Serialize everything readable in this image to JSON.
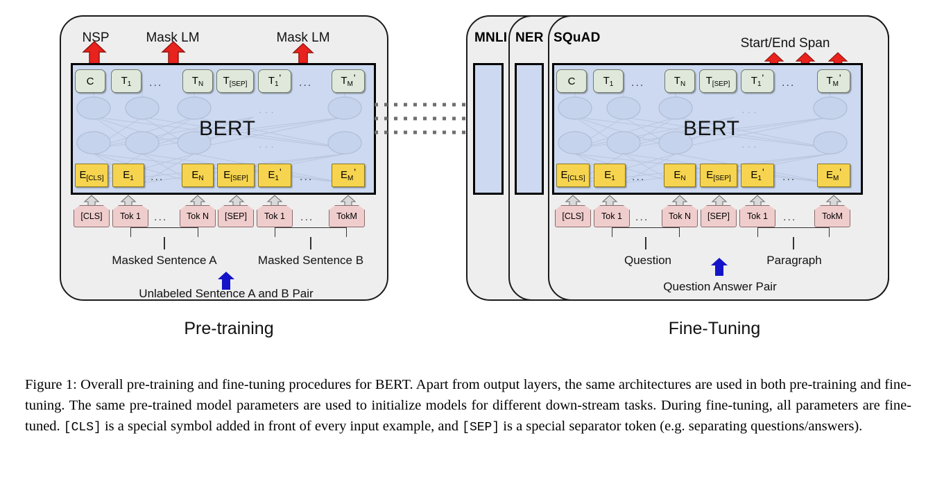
{
  "figure": {
    "left_panel": {
      "phase_label": "Pre-training",
      "top_labels": [
        {
          "text": "NSP"
        },
        {
          "text": "Mask LM"
        },
        {
          "text": "Mask LM"
        }
      ],
      "model_name": "BERT",
      "output_tokens": [
        {
          "main": "C",
          "sub": "",
          "prime": false
        },
        {
          "main": "T",
          "sub": "1",
          "prime": false
        },
        {
          "main": "T",
          "sub": "N",
          "prime": false
        },
        {
          "main": "T",
          "sub": "[SEP]",
          "prime": false
        },
        {
          "main": "T",
          "sub": "1",
          "prime": true
        },
        {
          "main": "T",
          "sub": "M",
          "prime": true
        }
      ],
      "embeddings": [
        {
          "main": "E",
          "sub": "[CLS]",
          "prime": false
        },
        {
          "main": "E",
          "sub": "1",
          "prime": false
        },
        {
          "main": "E",
          "sub": "N",
          "prime": false
        },
        {
          "main": "E",
          "sub": "[SEP]",
          "prime": false
        },
        {
          "main": "E",
          "sub": "1",
          "prime": true
        },
        {
          "main": "E",
          "sub": "M",
          "prime": true
        }
      ],
      "input_tokens": [
        "[CLS]",
        "Tok 1",
        "Tok N",
        "[SEP]",
        "Tok 1",
        "TokM"
      ],
      "group_labels": [
        "Masked Sentence A",
        "Masked Sentence B"
      ],
      "source_label": "Unlabeled Sentence A and B Pair",
      "ellipsis": "..."
    },
    "right_panel": {
      "phase_label": "Fine-Tuning",
      "task_tabs": [
        "MNLI",
        "NER",
        "SQuAD"
      ],
      "top_labels": [
        {
          "text": "Start/End Span"
        }
      ],
      "model_name": "BERT",
      "output_tokens": [
        {
          "main": "C",
          "sub": "",
          "prime": false
        },
        {
          "main": "T",
          "sub": "1",
          "prime": false
        },
        {
          "main": "T",
          "sub": "N",
          "prime": false
        },
        {
          "main": "T",
          "sub": "[SEP]",
          "prime": false
        },
        {
          "main": "T",
          "sub": "1",
          "prime": true
        },
        {
          "main": "T",
          "sub": "M",
          "prime": true
        }
      ],
      "embeddings": [
        {
          "main": "E",
          "sub": "[CLS]",
          "prime": false
        },
        {
          "main": "E",
          "sub": "1",
          "prime": false
        },
        {
          "main": "E",
          "sub": "N",
          "prime": false
        },
        {
          "main": "E",
          "sub": "[SEP]",
          "prime": false
        },
        {
          "main": "E",
          "sub": "1",
          "prime": true
        },
        {
          "main": "E",
          "sub": "M",
          "prime": true
        }
      ],
      "input_tokens": [
        "[CLS]",
        "Tok 1",
        "Tok N",
        "[SEP]",
        "Tok 1",
        "TokM"
      ],
      "group_labels": [
        "Question",
        "Paragraph"
      ],
      "source_label": "Question Answer Pair",
      "ellipsis": "..."
    },
    "transfer_arrows_count": 3,
    "colors": {
      "panel_bg": "#eeeeee",
      "bert_bg": "#ccd9f0",
      "output_token_bg": "#dfe8da",
      "embedding_bg": "#f6d44f",
      "input_token_bg": "#f0cdcd",
      "red_arrow": "#e8221c",
      "blue_arrow": "#1414c8",
      "gray_arrow": "#d4d4d4",
      "transfer_arrow": "#6e6e6e"
    }
  },
  "caption": {
    "p1": "Figure 1: Overall pre-training and fine-tuning procedures for BERT. Apart from output layers, the same architectures are used in both pre-training and fine-tuning. The same pre-trained model parameters are used to initialize models for different down-stream tasks. During fine-tuning, all parameters are fine-tuned. ",
    "cls": "[CLS]",
    "p2": " is a special symbol added in front of every input example, and ",
    "sep": "[SEP]",
    "p3": " is a special separator token (e.g. separating questions/answers)."
  }
}
